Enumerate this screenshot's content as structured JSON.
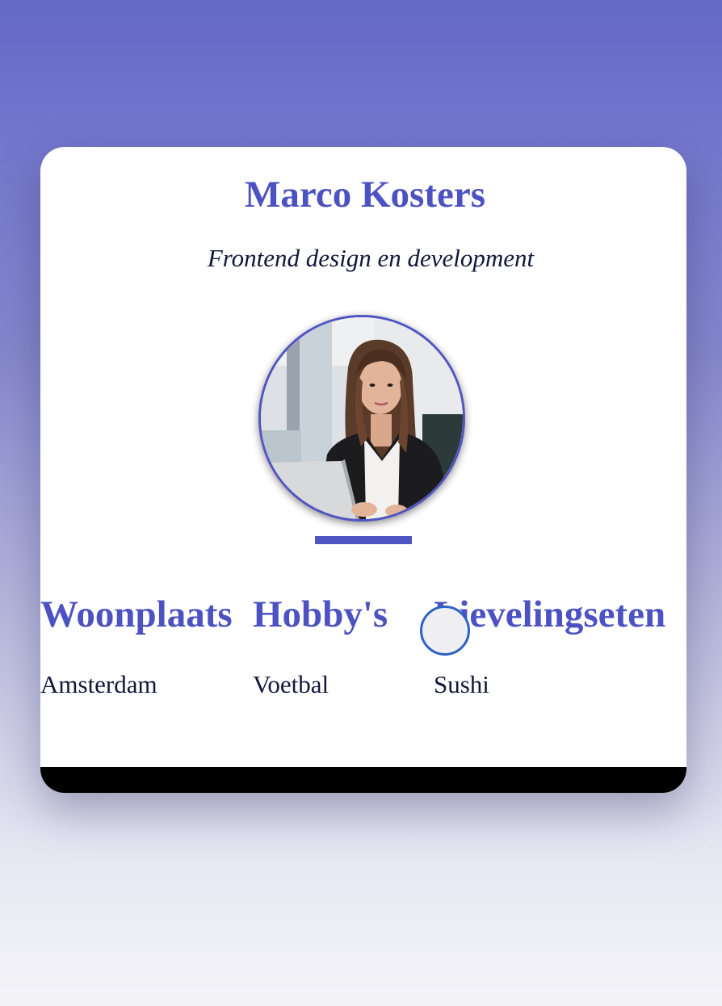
{
  "profile": {
    "name": "Marco Kosters",
    "subtitle": "Frontend design en development",
    "photo_icon": "profile-photo"
  },
  "info": [
    {
      "heading": "Woonplaats",
      "value": "Amsterdam"
    },
    {
      "heading": "Hobby's",
      "value": "Voetbal"
    },
    {
      "heading": "Lievelingseten",
      "value": "Sushi"
    }
  ],
  "colors": {
    "accent": "#4c52c1",
    "text": "#10173a",
    "card": "#ffffff",
    "footer": "#000000",
    "pointer_ring": "#2e62c4"
  }
}
